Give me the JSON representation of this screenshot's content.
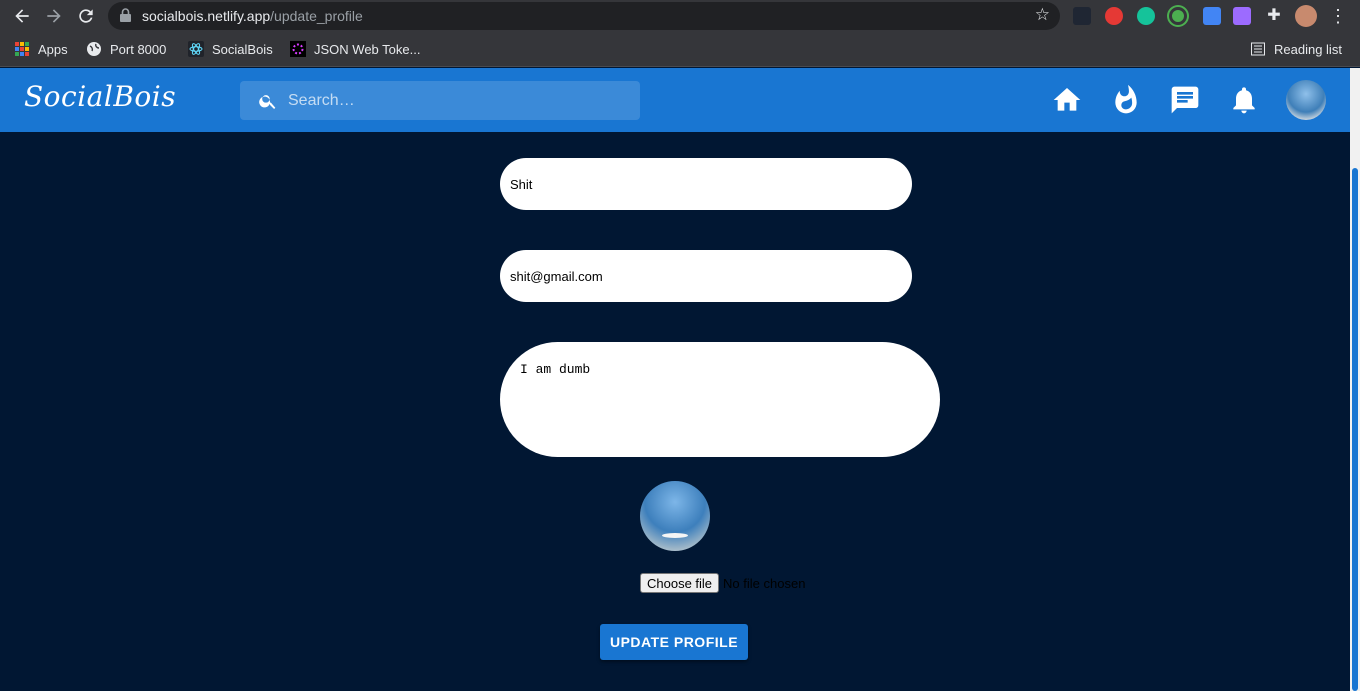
{
  "browser": {
    "url_host": "socialbois.netlify.app",
    "url_path": "/update_profile",
    "bookmarks": [
      {
        "label": "Apps",
        "icon": "apps-grid-icon"
      },
      {
        "label": "Port 8000",
        "icon": "globe-icon"
      },
      {
        "label": "SocialBois",
        "icon": "react-icon"
      },
      {
        "label": "JSON Web Toke...",
        "icon": "jwt-icon"
      }
    ],
    "reading_list": "Reading list"
  },
  "header": {
    "logo": "SocialBois",
    "search_placeholder": "Search…",
    "icons": [
      "home-icon",
      "whatshot-icon",
      "chat-icon",
      "notifications-icon"
    ]
  },
  "form": {
    "name_value": "Shit",
    "email_value": "shit@gmail.com",
    "bio_value": "I am dumb",
    "choose_file_label": "Choose file",
    "no_file_text": "No file chosen",
    "submit_label": "UPDATE PROFILE"
  },
  "colors": {
    "primary": "#1976d2",
    "background": "#011733"
  }
}
